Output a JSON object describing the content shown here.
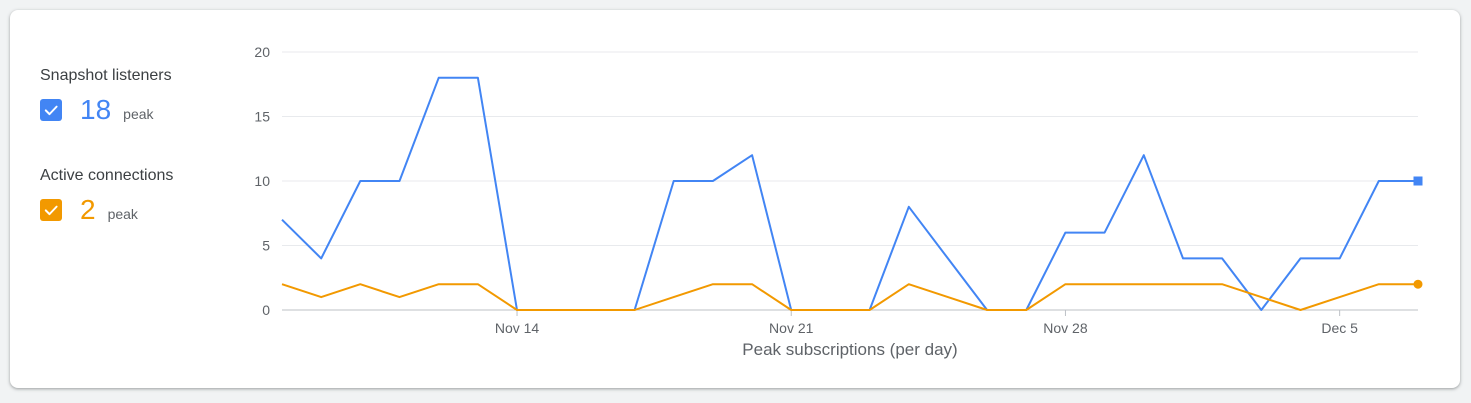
{
  "metrics": [
    {
      "title": "Snapshot listeners",
      "value": "18",
      "unit": "peak",
      "color": "#4285f4",
      "checked": true,
      "icon": "checkmark-icon"
    },
    {
      "title": "Active connections",
      "value": "2",
      "unit": "peak",
      "color": "#f29900",
      "checked": true,
      "icon": "checkmark-icon"
    }
  ],
  "chart_data": {
    "type": "line",
    "xlabel": "Peak subscriptions (per day)",
    "ylabel": "",
    "ylim": [
      0,
      20
    ],
    "yticks": [
      0,
      5,
      10,
      15,
      20
    ],
    "grid": true,
    "x_tick_labels": [
      {
        "label": "Nov 14",
        "index": 6
      },
      {
        "label": "Nov 21",
        "index": 13
      },
      {
        "label": "Nov 28",
        "index": 20
      },
      {
        "label": "Dec 5",
        "index": 27
      }
    ],
    "series": [
      {
        "name": "Snapshot listeners",
        "color": "#4285f4",
        "end_marker": "square",
        "values": [
          7,
          4,
          10,
          10,
          18,
          18,
          0,
          0,
          0,
          0,
          10,
          10,
          12,
          0,
          0,
          0,
          8,
          4,
          0,
          0,
          6,
          6,
          12,
          4,
          4,
          0,
          4,
          4,
          10,
          10
        ]
      },
      {
        "name": "Active connections",
        "color": "#f29900",
        "end_marker": "circle",
        "values": [
          2,
          1,
          2,
          1,
          2,
          2,
          0,
          0,
          0,
          0,
          1,
          2,
          2,
          0,
          0,
          0,
          2,
          1,
          0,
          0,
          2,
          2,
          2,
          2,
          2,
          1,
          0,
          1,
          2,
          2
        ]
      }
    ]
  }
}
